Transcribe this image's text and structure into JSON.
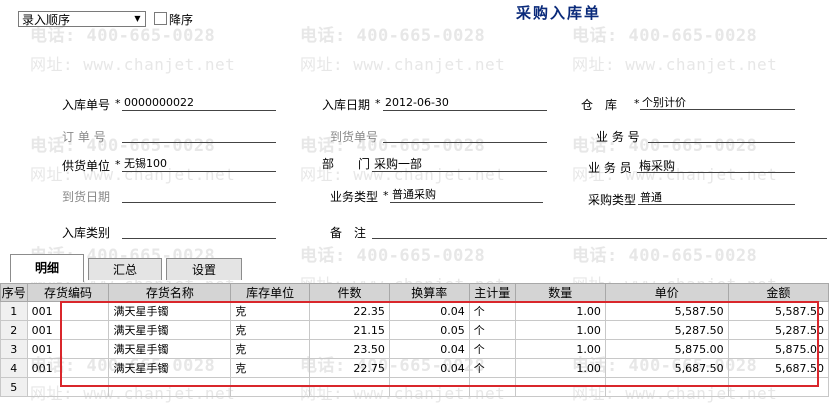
{
  "watermark": {
    "phone": "电话: 400-665-0028",
    "site": "网址: www.chanjet.net"
  },
  "toolbar": {
    "order_select": "录入顺序",
    "desc_label": "降序"
  },
  "title": "采购入库单",
  "form": {
    "receipt_no_label": "入库单号",
    "receipt_no": "0000000022",
    "receipt_date_label": "入库日期",
    "receipt_date": "2012-06-30",
    "warehouse_label": "仓　库",
    "warehouse": "个别计价",
    "order_no_label": "订 单 号",
    "arrival_no_label": "到货单号",
    "business_no_label": "业 务 号",
    "supplier_label": "供货单位",
    "supplier": "无锡100",
    "dept_label": "部　　门",
    "dept": "采购一部",
    "salesman_label": "业 务 员",
    "salesman": "梅采购",
    "arrival_date_label": "到货日期",
    "biz_type_label": "业务类型",
    "biz_type": "普通采购",
    "purchase_type_label": "采购类型",
    "purchase_type": "普通",
    "in_type_label": "入库类别",
    "memo_label": "备　注"
  },
  "tabs": [
    "明细",
    "汇总",
    "设置"
  ],
  "table": {
    "headers": [
      "序号",
      "存货编码",
      "存货名称",
      "库存单位",
      "件数",
      "换算率",
      "主计量",
      "数量",
      "单价",
      "金额"
    ],
    "rows": [
      [
        "1",
        "001",
        "满天星手镯",
        "克",
        "22.35",
        "0.04",
        "个",
        "1.00",
        "5,587.50",
        "5,587.50"
      ],
      [
        "2",
        "001",
        "满天星手镯",
        "克",
        "21.15",
        "0.05",
        "个",
        "1.00",
        "5,287.50",
        "5,287.50"
      ],
      [
        "3",
        "001",
        "满天星手镯",
        "克",
        "23.50",
        "0.04",
        "个",
        "1.00",
        "5,875.00",
        "5,875.00"
      ],
      [
        "4",
        "001",
        "满天星手镯",
        "克",
        "22.75",
        "0.04",
        "个",
        "1.00",
        "5,687.50",
        "5,687.50"
      ],
      [
        "5",
        "",
        "",
        "",
        "",
        "",
        "",
        "",
        "",
        ""
      ]
    ]
  },
  "colors": {
    "title": "#0a2a7a",
    "highlight_border": "#d9262b",
    "header_bg": "#d4d4d4"
  }
}
